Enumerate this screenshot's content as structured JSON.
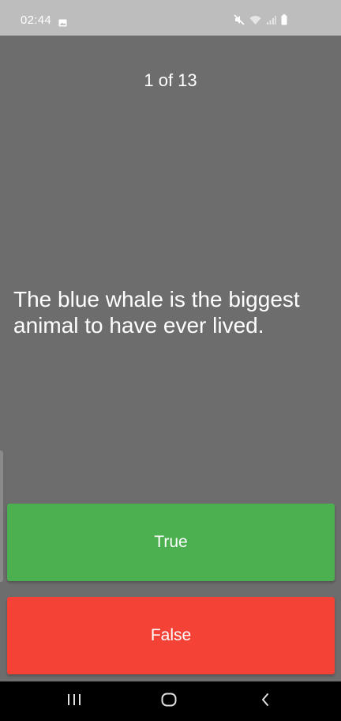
{
  "status_bar": {
    "time": "02:44",
    "icons": [
      "gallery-icon",
      "mute-icon",
      "wifi-icon",
      "signal-icon",
      "battery-icon"
    ]
  },
  "quiz": {
    "counter": "1 of 13",
    "question": "The blue whale is the biggest animal to have ever lived.",
    "true_label": "True",
    "false_label": "False"
  },
  "colors": {
    "background": "#6d6d6d",
    "true_button": "#4caf50",
    "false_button": "#f44336",
    "status_bar": "#bdbdbd",
    "nav_bar": "#000000"
  },
  "nav_bar": {
    "icons": [
      "recents-icon",
      "home-icon",
      "back-icon"
    ]
  }
}
